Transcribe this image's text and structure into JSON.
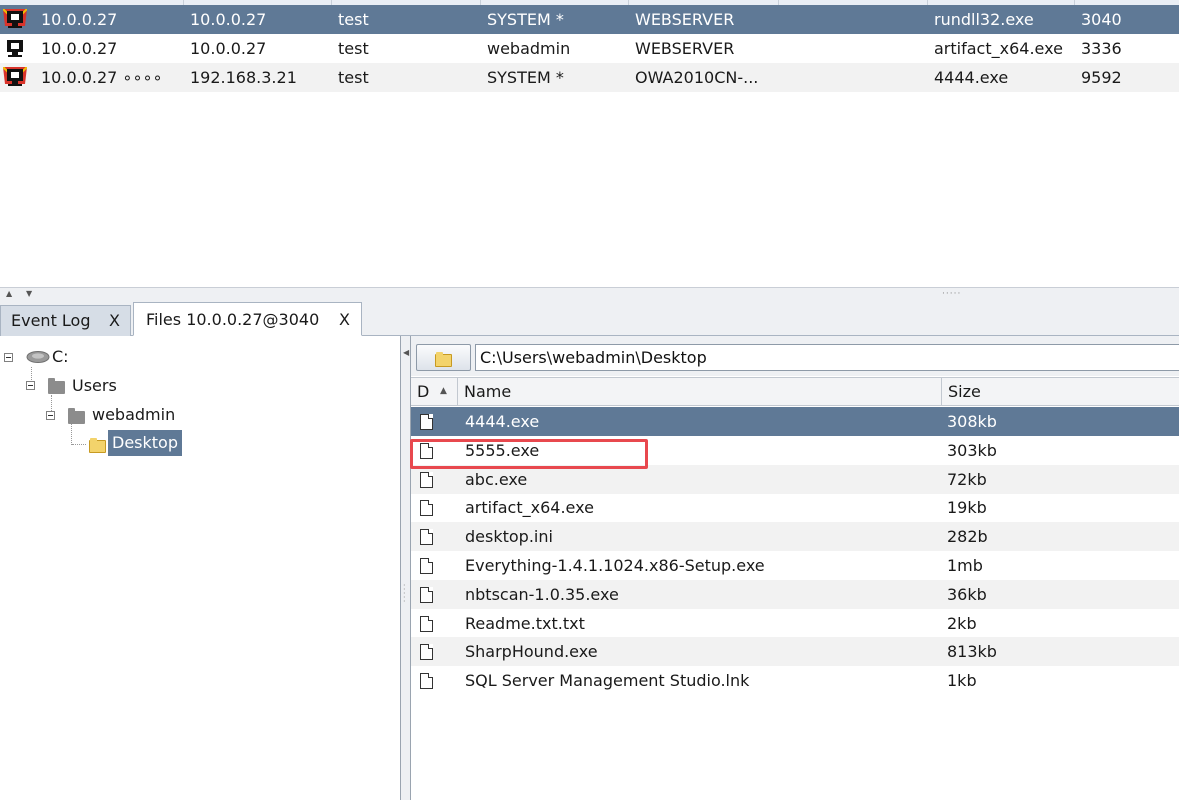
{
  "beacons": [
    {
      "external": "10.0.0.27",
      "internal": "10.0.0.27",
      "listener": "test",
      "user": "SYSTEM *",
      "computer": "WEBSERVER",
      "process": "rundll32.exe",
      "pid": "3040",
      "selected": true,
      "icon": "beacon-admin-icon"
    },
    {
      "external": "10.0.0.27",
      "internal": "10.0.0.27",
      "listener": "test",
      "user": "webadmin",
      "computer": "WEBSERVER",
      "process": "artifact_x64.exe",
      "pid": "3336",
      "selected": false,
      "icon": "beacon-user-icon"
    },
    {
      "external": "10.0.0.27 ∘∘∘∘",
      "internal": "192.168.3.21",
      "listener": "test",
      "user": "SYSTEM *",
      "computer": "OWA2010CN-...",
      "process": "4444.exe",
      "pid": "9592",
      "selected": false,
      "icon": "beacon-admin-icon"
    }
  ],
  "tabs": [
    {
      "label": "Event Log",
      "close": "X",
      "active": false
    },
    {
      "label": "Files 10.0.0.27@3040",
      "close": "X",
      "active": true
    }
  ],
  "tree": {
    "drive": "C:",
    "users": "Users",
    "webadmin": "webadmin",
    "desktop": "Desktop"
  },
  "path": "C:\\Users\\webadmin\\Desktop",
  "columns": {
    "d": "D",
    "name": "Name",
    "size": "Size"
  },
  "files": [
    {
      "name": "4444.exe",
      "size": "308kb"
    },
    {
      "name": "5555.exe",
      "size": "303kb"
    },
    {
      "name": "abc.exe",
      "size": "72kb"
    },
    {
      "name": "artifact_x64.exe",
      "size": "19kb"
    },
    {
      "name": "desktop.ini",
      "size": "282b"
    },
    {
      "name": "Everything-1.4.1.1024.x86-Setup.exe",
      "size": "1mb"
    },
    {
      "name": "nbtscan-1.0.35.exe",
      "size": "36kb"
    },
    {
      "name": "Readme.txt.txt",
      "size": "2kb"
    },
    {
      "name": "SharpHound.exe",
      "size": "813kb"
    },
    {
      "name": "SQL Server Management Studio.lnk",
      "size": "1kb"
    }
  ],
  "selected_file_index": 0,
  "highlighted_file_index": 1,
  "colors": {
    "selection": "#5f7996",
    "highlight": "#e8484e"
  }
}
